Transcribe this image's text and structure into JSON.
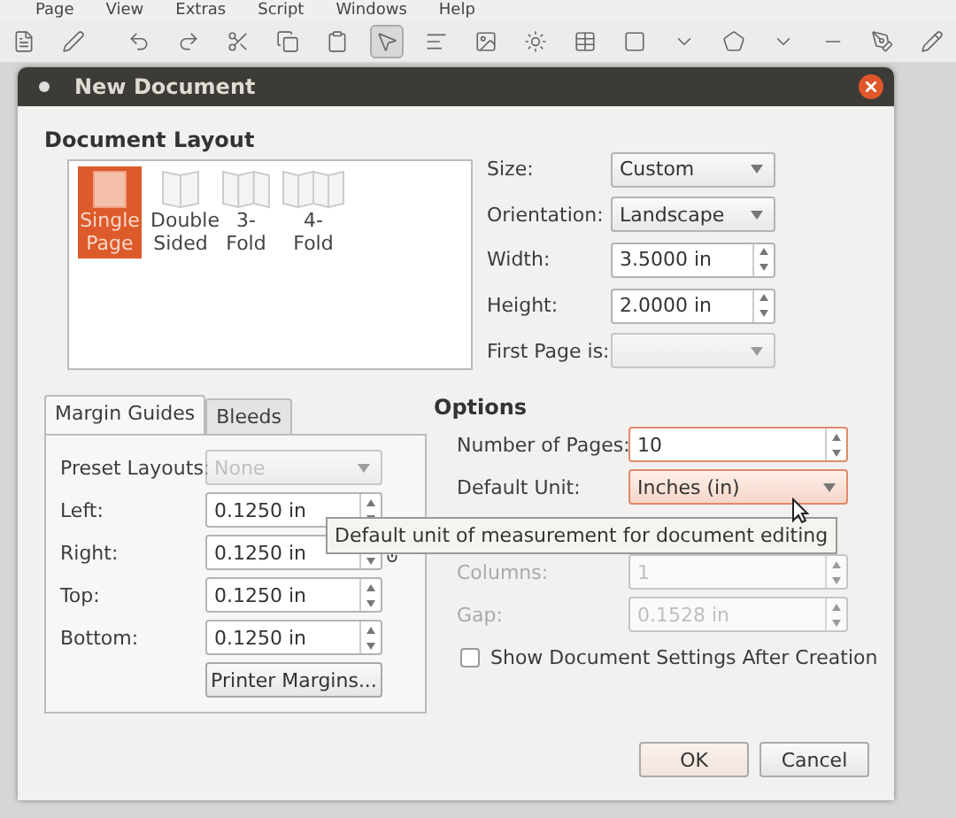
{
  "menu": [
    "Page",
    "View",
    "Extras",
    "Script",
    "Windows",
    "Help"
  ],
  "dialog": {
    "title": "New Document"
  },
  "document_layout": {
    "heading": "Document Layout",
    "layouts": [
      {
        "kind": "single",
        "label": "Single Page",
        "selected": true
      },
      {
        "kind": "double",
        "label": "Double Sided",
        "selected": false
      },
      {
        "kind": "fold3",
        "label": "3-Fold",
        "selected": false
      },
      {
        "kind": "fold4",
        "label": "4-Fold",
        "selected": false
      }
    ],
    "fields": [
      {
        "kind": "select",
        "label": "Size:",
        "value": "Custom",
        "disabled": false
      },
      {
        "kind": "select",
        "label": "Orientation:",
        "value": "Landscape",
        "disabled": false
      },
      {
        "kind": "spin",
        "label": "Width:",
        "value": "3.5000 in",
        "disabled": false
      },
      {
        "kind": "spin",
        "label": "Height:",
        "value": "2.0000 in",
        "disabled": false
      },
      {
        "kind": "select",
        "label": "First Page is:",
        "disabled": true
      }
    ]
  },
  "margins": {
    "tabs": [
      {
        "label": "Margin Guides",
        "selected": true
      },
      {
        "label": "Bleeds",
        "selected": false
      }
    ],
    "fields": [
      {
        "kind": "select",
        "label": "Preset Layouts:",
        "value": "None",
        "disabled": true
      },
      {
        "kind": "spin",
        "label": "Left:",
        "value": "0.1250 in",
        "disabled": false
      },
      {
        "kind": "spin",
        "label": "Right:",
        "value": "0.1250 in",
        "disabled": false
      },
      {
        "kind": "spin",
        "label": "Top:",
        "value": "0.1250 in",
        "disabled": false
      },
      {
        "kind": "spin",
        "label": "Bottom:",
        "value": "0.1250 in",
        "disabled": false
      }
    ],
    "button": "Printer Margins..."
  },
  "options": {
    "heading": "Options",
    "fields": [
      {
        "kind": "spin",
        "label": "Number of Pages:",
        "value": "10",
        "disabled": false,
        "focused": true
      },
      {
        "kind": "select",
        "label": "Default Unit:",
        "value": "Inches (in)",
        "disabled": false,
        "focused": true
      },
      {
        "kind": "spin",
        "label": "Columns:",
        "value": "1",
        "disabled": true,
        "focused": false
      },
      {
        "kind": "spin",
        "label": "Gap:",
        "value": "0.1528 in",
        "disabled": true,
        "focused": false
      }
    ],
    "checkbox": {
      "label": "Show Document Settings After Creation",
      "checked": false
    }
  },
  "tooltip": "Default unit of measurement for document editing",
  "buttons": [
    {
      "label": "OK",
      "kind": "default"
    },
    {
      "label": "Cancel",
      "kind": "normal"
    }
  ]
}
